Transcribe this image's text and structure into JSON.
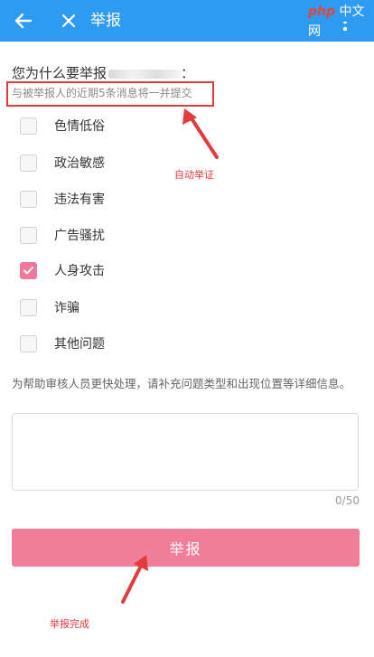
{
  "appbar": {
    "title": "举报",
    "back_icon": "arrow-left-icon",
    "close_icon": "close-icon",
    "more_icon": "more-vertical-icon",
    "color": "#2f9bf0"
  },
  "watermark": {
    "php": "php",
    "site": "中文网"
  },
  "reason": {
    "heading": "您为什么要举报",
    "heading_suffix": "：",
    "notice": "与被举报人的近期5条消息将一并提交"
  },
  "options": [
    {
      "label": "色情低俗",
      "checked": false
    },
    {
      "label": "政治敏感",
      "checked": false
    },
    {
      "label": "违法有害",
      "checked": false
    },
    {
      "label": "广告骚扰",
      "checked": false
    },
    {
      "label": "人身攻击",
      "checked": true
    },
    {
      "label": "诈骗",
      "checked": false
    },
    {
      "label": "其他问题",
      "checked": false
    }
  ],
  "annotations": {
    "auto_evidence": "自动举证",
    "report_done": "举报完成",
    "color": "#e23b3b"
  },
  "helper_text": "为帮助审核人员更快处理，请补充问题类型和出现位置等详细信息。",
  "details_input": {
    "value": "",
    "placeholder": ""
  },
  "counter": "0/50",
  "submit": {
    "label": "举报",
    "color": "#f27d98"
  }
}
